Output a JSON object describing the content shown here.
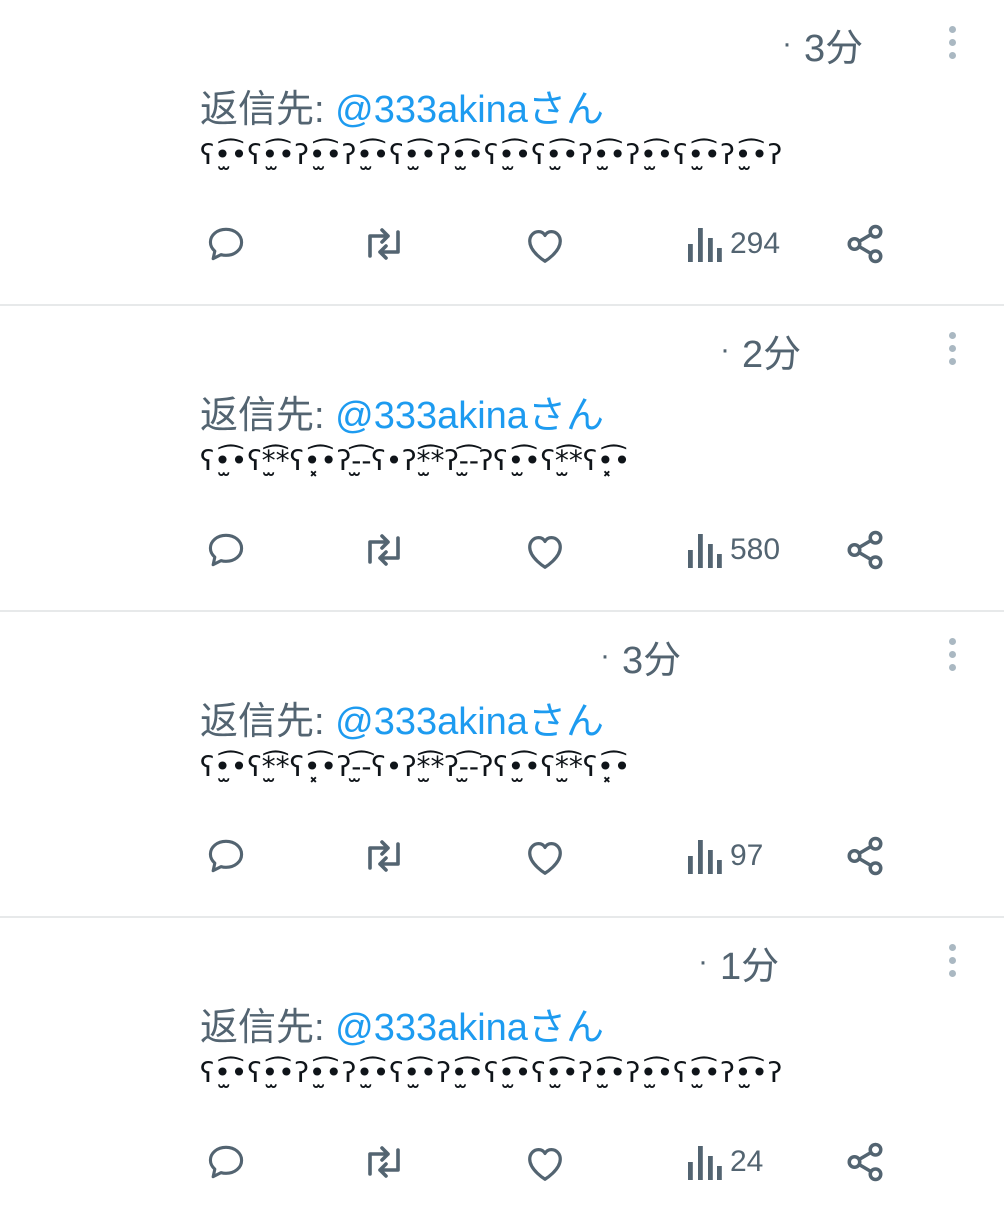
{
  "tweets": [
    {
      "time": "3分",
      "reply_prefix": "返信先:",
      "reply_handle": "@333akina",
      "reply_suffix": "さん",
      "content": "ʕ•̫͡•ʕ•̫͡•ʔ•̫͡•ʔ•̫͡•ʕ•̫͡•ʔ•̫͡•ʕ•̫͡•ʕ•̫͡•ʔ•̫͡•ʔ•̫͡•ʕ•̫͡•ʔ•̫͡•ʔ",
      "views": "294"
    },
    {
      "time": "2分",
      "reply_prefix": "返信先:",
      "reply_handle": "@333akina",
      "reply_suffix": "さん",
      "content": "ʕ•̫͡•ʕ*̫͡*ʕ•͓͡•ʔ-̫͡-ʕ•ʔ*̫͡*ʔ-̫͡-ʔʕ•̫͡•ʕ*̫͡*ʕ•͓͡•",
      "views": "580"
    },
    {
      "time": "3分",
      "reply_prefix": "返信先:",
      "reply_handle": "@333akina",
      "reply_suffix": "さん",
      "content": "ʕ•̫͡•ʕ*̫͡*ʕ•͓͡•ʔ-̫͡-ʕ•ʔ*̫͡*ʔ-̫͡-ʔʕ•̫͡•ʕ*̫͡*ʕ•͓͡•",
      "views": "97"
    },
    {
      "time": "1分",
      "reply_prefix": "返信先:",
      "reply_handle": "@333akina",
      "reply_suffix": "さん",
      "content": "ʕ•̫͡•ʕ•̫͡•ʔ•̫͡•ʔ•̫͡•ʕ•̫͡•ʔ•̫͡•ʕ•̫͡•ʕ•̫͡•ʔ•̫͡•ʔ•̫͡•ʕ•̫͡•ʔ•̫͡•ʔ",
      "views": "24"
    }
  ],
  "icons": {
    "reply": "reply-icon",
    "retweet": "retweet-icon",
    "like": "heart-icon",
    "views": "views-icon",
    "share": "share-icon",
    "more": "more-vertical-icon"
  },
  "colors": {
    "accent": "#1d9bf0",
    "secondary_text": "#536471",
    "icon": "#536471",
    "divider": "#e7e9ea"
  }
}
